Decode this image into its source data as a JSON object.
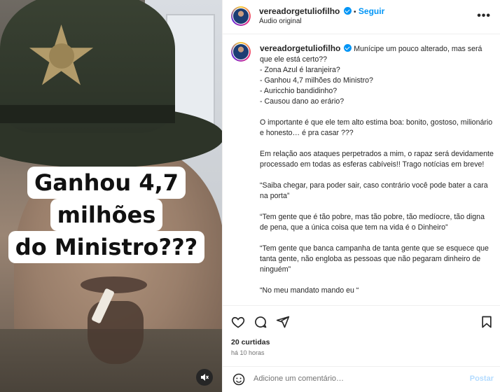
{
  "post": {
    "author": "vereadorgetuliofilho",
    "follow_label": "Seguir",
    "separator": "•",
    "audio": "Áudio original",
    "more_label": "•••",
    "overlay_lines": [
      "Ganhou 4,7",
      "milhões",
      "do Ministro???"
    ]
  },
  "caption": {
    "author": "vereadorgetuliofilho",
    "first_line": "Munícipe um pouco alterado, mas será que ele está certo??",
    "list": [
      "- Zona Azul é laranjeira?",
      "- Ganhou 4,7 milhões do Ministro?",
      "- Auricchio bandidinho?",
      "- Causou dano ao erário?"
    ],
    "paragraphs": [
      "O importante é que ele tem alto estima boa: bonito, gostoso, milionário e honesto… é pra casar ???",
      "Em relação aos ataques perpetrados a mim, o rapaz será devidamente processado em todas as esferas cabíveis!! Trago notícias em breve!",
      "“Saiba chegar, para poder sair, caso contrário você pode bater a cara na porta”",
      "“Tem gente que é tão pobre, mas tão pobre, tão medíocre, tão digna de pena, que a única coisa que tem na vida é o Dinheiro”",
      "“Tem gente que banca campanha de tanta gente que se esquece que tanta gente, não engloba as pessoas que não pegaram dinheiro de ninguém”",
      "“No meu mandato mando eu “"
    ]
  },
  "stats": {
    "likes": "20 curtidas",
    "time": "há 10 horas"
  },
  "comment": {
    "placeholder": "Adicione um comentário…",
    "post_label": "Postar"
  },
  "icons": [
    "heart-icon",
    "comment-icon",
    "share-icon",
    "bookmark-icon",
    "emoji-icon",
    "mute-icon",
    "verified-icon",
    "more-icon"
  ],
  "colors": {
    "link": "#0095f6",
    "verified": "#0095f6",
    "post_disabled": "#b3dbff"
  }
}
